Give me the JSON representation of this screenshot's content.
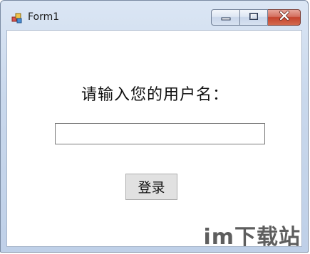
{
  "window": {
    "title": "Form1",
    "icon": "winforms-app-icon",
    "controls": {
      "minimize": "minimize-icon",
      "maximize": "maximize-icon",
      "close": "close-icon"
    }
  },
  "form": {
    "prompt_label": "请输入您的用户名：",
    "username_value": "",
    "login_button_label": "登录"
  },
  "watermark": "im下载站",
  "colors": {
    "close_button": "#c4432d",
    "titlebar": "#c9d8ec",
    "button_face": "#e1e1e1"
  }
}
